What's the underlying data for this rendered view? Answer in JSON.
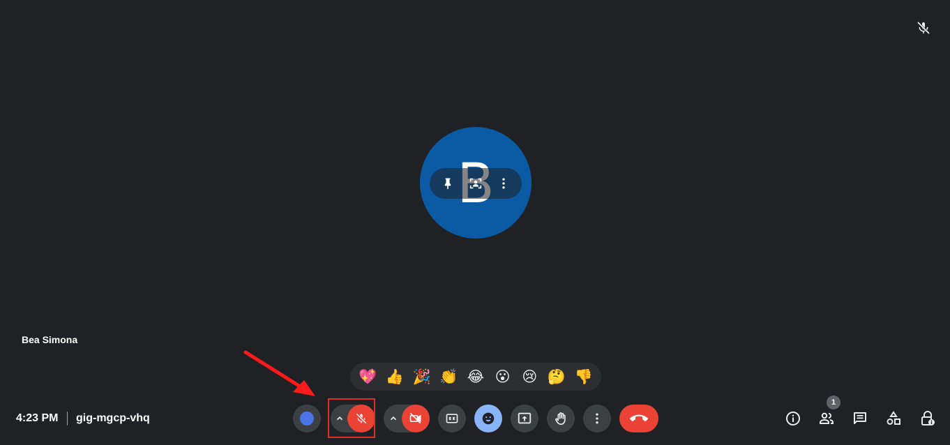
{
  "participant": {
    "name": "Bea Simona",
    "initial": "B",
    "avatar_color": "#0b5aa4"
  },
  "reactions": [
    "💖",
    "👍",
    "🎉",
    "👏",
    "😂",
    "😮",
    "😢",
    "🤔",
    "👎"
  ],
  "footer": {
    "time": "4:23 PM",
    "meeting_code": "gig-mgcp-vhq"
  },
  "controls": {
    "mic": "muted",
    "camera": "off",
    "accent_red": "#ea4335",
    "accent_blue": "#8ab4f8"
  },
  "right_panel": {
    "people_count": "1"
  },
  "annotation": {
    "highlight_color": "#d93025",
    "target": "microphone-button"
  },
  "icons": {
    "tile": [
      "pin-icon",
      "frame-person-icon",
      "more-vert-icon"
    ],
    "bar": [
      "effects-icon",
      "chevron-up-icon",
      "mic-off-icon",
      "chevron-up-icon",
      "videocam-off-icon",
      "closed-caption-icon",
      "emoji-icon",
      "present-screen-icon",
      "raise-hand-icon",
      "more-vert-icon",
      "call-end-icon"
    ],
    "right": [
      "info-icon",
      "people-icon",
      "chat-icon",
      "activities-icon",
      "host-controls-icon"
    ]
  }
}
